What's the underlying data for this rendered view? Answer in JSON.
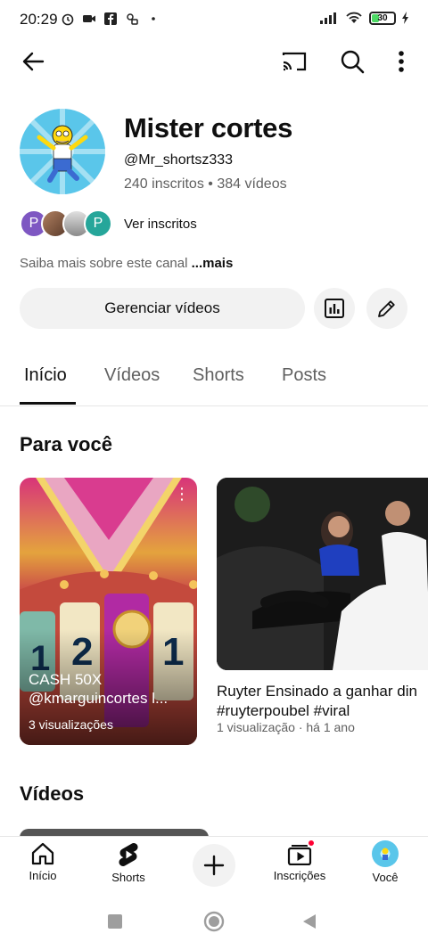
{
  "status_bar": {
    "time": "20:29",
    "battery": "30"
  },
  "app_bar": {
    "back_icon": "arrow-left-icon",
    "cast_icon": "cast-icon",
    "search_icon": "search-icon",
    "more_icon": "more-vert-icon"
  },
  "channel": {
    "name": "Mister cortes",
    "handle": "@Mr_shortsz333",
    "stats": "240 inscritos • 384 vídeos",
    "subscribers_link": "Ver inscritos",
    "subscriber_avatars": [
      "P",
      "",
      "",
      "P"
    ],
    "about_prefix": "Saiba mais sobre este canal ",
    "about_more": "...mais",
    "manage_button": "Gerenciar vídeos"
  },
  "tabs": [
    {
      "label": "Início",
      "active": true
    },
    {
      "label": "Vídeos",
      "active": false
    },
    {
      "label": "Shorts",
      "active": false
    },
    {
      "label": "Posts",
      "active": false
    }
  ],
  "sections": {
    "for_you": "Para você",
    "videos": "Vídeos"
  },
  "cards": [
    {
      "title": "CASH 50X @kmarguincortes l...",
      "meta": "3 visualizações"
    },
    {
      "title": "Ruyter Ensinado a ganhar dinheiro #ruyterpoubel #viral",
      "title_line1": "Ruyter Ensinado a ganhar din",
      "title_line2": "#ruyterpoubel #viral",
      "meta": "1 visualização · há 1 ano"
    }
  ],
  "bottom_nav": [
    {
      "label": "Início",
      "icon": "home-icon"
    },
    {
      "label": "Shorts",
      "icon": "shorts-icon"
    },
    {
      "label": "",
      "icon": "create-plus-icon"
    },
    {
      "label": "Inscrições",
      "icon": "subscriptions-icon"
    },
    {
      "label": "Você",
      "icon": "profile-avatar"
    }
  ],
  "colors": {
    "accent": "#0f0f0f",
    "muted": "#606060",
    "chip_bg": "#f2f2f2",
    "notif_dot": "#ff0033"
  }
}
